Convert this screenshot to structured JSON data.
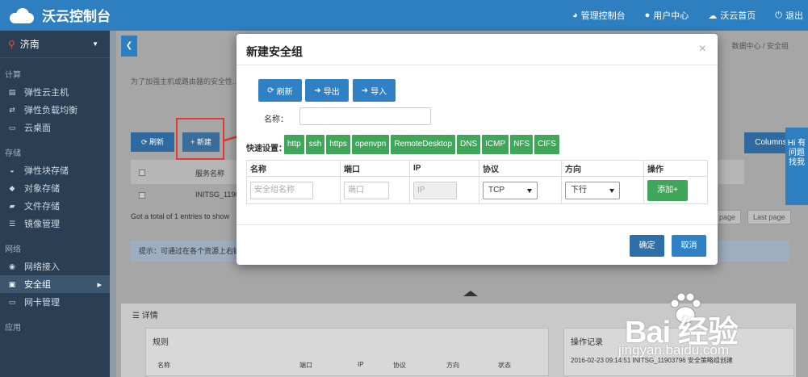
{
  "app": {
    "brand": "沃云控制台"
  },
  "topnav": [
    {
      "icon": "dashboard-icon",
      "label": "管理控制台"
    },
    {
      "icon": "user-icon",
      "label": "用户中心"
    },
    {
      "icon": "cloud-icon",
      "label": "沃云首页"
    },
    {
      "icon": "power-icon",
      "label": "退出"
    }
  ],
  "sidebar": {
    "location": "济南",
    "sections": [
      {
        "title": "计算",
        "items": [
          "弹性云主机",
          "弹性负载均衡",
          "云桌面"
        ]
      },
      {
        "title": "存储",
        "items": [
          "弹性块存储",
          "对象存储",
          "文件存储",
          "镜像管理"
        ]
      },
      {
        "title": "网络",
        "items": [
          "网络接入",
          "安全组",
          "网卡管理"
        ]
      },
      {
        "title": "应用",
        "items": []
      }
    ],
    "active": "安全组"
  },
  "page": {
    "breadcrumbs": "数据中心 / 安全组",
    "notice": "为了加强主机或路由器的安全性...",
    "refresh": "刷新",
    "new": "+ 新建",
    "col_name": "服务名称",
    "row_name": "INITSG_1190",
    "total": "Got a total of 1 entries to show",
    "hint": "提示：可通过在各个资源上右键...",
    "columns": "Columns",
    "pager_prev": "page",
    "pager_last": "Last page",
    "detail_tab": "详情",
    "rules_title": "规则",
    "rules_cols": [
      "名称",
      "端口",
      "IP",
      "协议",
      "方向",
      "状态"
    ],
    "log_title": "操作记录",
    "log_line": "2016-02-23 09:14:51 INITSG_11903796 安全策略组创建",
    "feedback": "Hi 有问题 找我"
  },
  "modal": {
    "title": "新建安全组",
    "close": "×",
    "toolbar": {
      "refresh": "刷新",
      "export": "导出",
      "import": "导入"
    },
    "name_label": "名称：",
    "name_value": "",
    "quick_label": "快速设置：",
    "quick_tags": [
      "http",
      "ssh",
      "https",
      "openvpn",
      "RemoteDesktop",
      "DNS",
      "ICMP",
      "NFS",
      "CIFS"
    ],
    "headers": [
      "名称",
      "端口",
      "IP",
      "协议",
      "方向",
      "操作"
    ],
    "row": {
      "name_placeholder": "安全组名称",
      "port_placeholder": "端口",
      "ip_placeholder": "IP",
      "protocol": "TCP",
      "direction": "下行",
      "add": "添加+"
    },
    "ok": "确定",
    "cancel": "取消"
  },
  "watermark": {
    "logo": "Bai 经验",
    "url": "jingyan.baidu.com"
  },
  "colors": {
    "primary": "#2f80c5",
    "green": "#3fa65a",
    "sidebar": "#2a3f54",
    "highlight": "#e53935"
  }
}
